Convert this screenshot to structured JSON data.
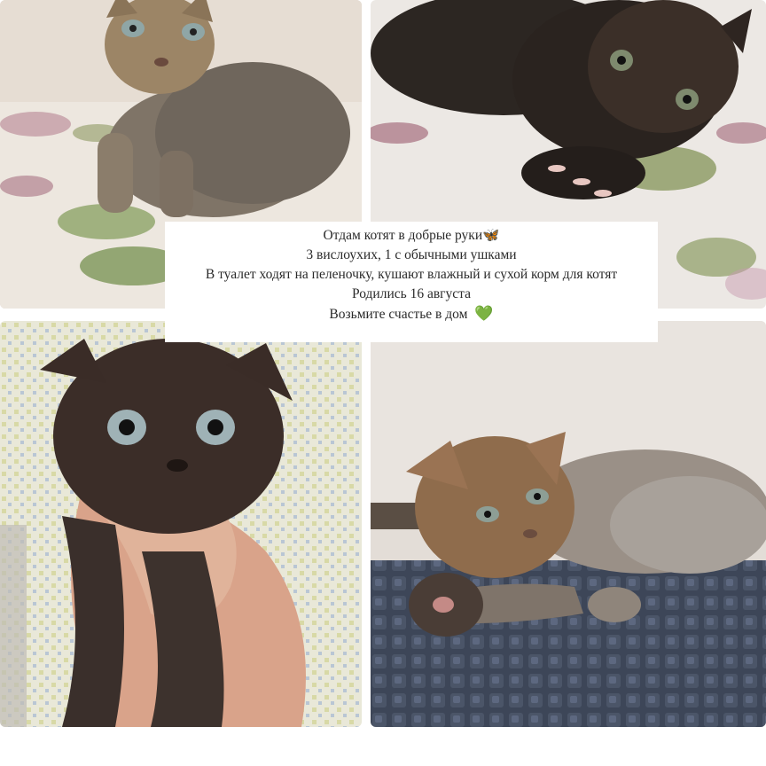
{
  "photos": [
    {
      "subject": "tabby kitten sitting on a floral blanket"
    },
    {
      "subject": "dark kitten lying on a floral blanket"
    },
    {
      "subject": "dark fold-eared kitten held in a hand"
    },
    {
      "subject": "tabby fold kitten lying on a dark mat"
    }
  ],
  "caption": {
    "line1": "Отдам котят в добрые руки",
    "line1_emoji": "🦋",
    "line2": "3 вислоухих, 1 с обычными ушками",
    "line3": "В туалет ходят на пеленочку, кушают влажный и сухой корм для котят",
    "line4": "Родились 16 августа",
    "line5": "Возьмите счастье в дом",
    "line5_emoji": "💚"
  },
  "colors": {
    "caption_text": "#2a2a2a",
    "butterfly": "#f2b51a",
    "heart": "#39b54a"
  }
}
